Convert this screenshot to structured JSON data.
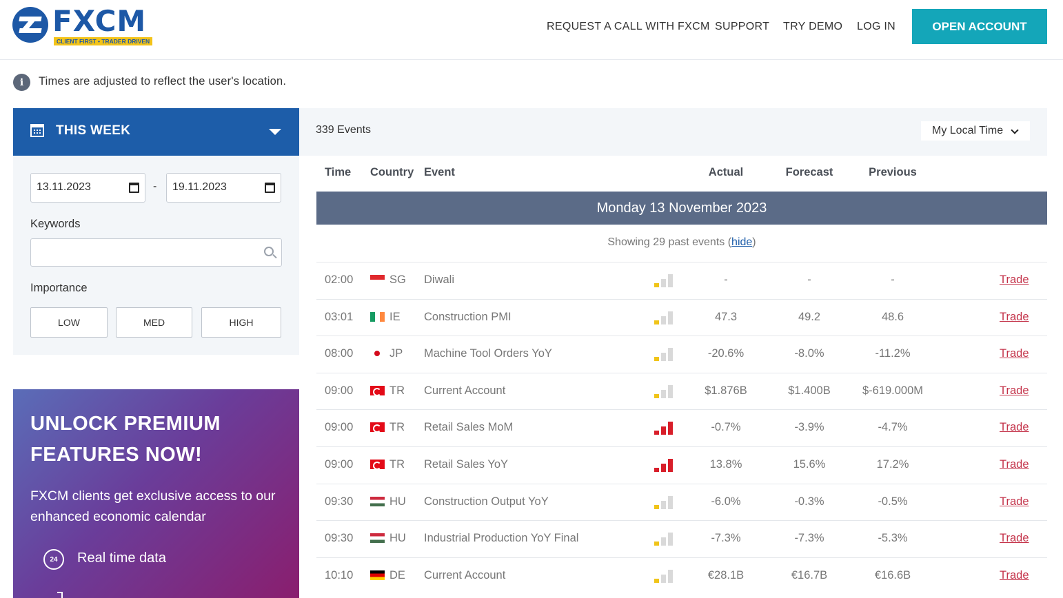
{
  "header": {
    "logo_text": "FXCM",
    "logo_tagline": "CLIENT FIRST • TRADER DRIVEN",
    "nav": [
      {
        "label": "REQUEST A CALL WITH FXCM"
      },
      {
        "label": "SUPPORT"
      },
      {
        "label": "TRY DEMO"
      },
      {
        "label": "LOG IN"
      }
    ],
    "open_account": "OPEN ACCOUNT"
  },
  "info": {
    "icon": "i",
    "text": "Times are adjusted to reflect the user's location."
  },
  "filters": {
    "period": "THIS WEEK",
    "date_from": "13.11.2023",
    "date_sep": "-",
    "date_to": "19.11.2023",
    "keywords_label": "Keywords",
    "keywords_value": "",
    "importance_label": "Importance",
    "importance_buttons": [
      "LOW",
      "MED",
      "HIGH"
    ]
  },
  "promo": {
    "title_line1": "UNLOCK PREMIUM",
    "title_line2": "FEATURES NOW!",
    "description": "FXCM clients get exclusive access to our enhanced economic calendar",
    "feature_icon_text": "24",
    "feature": "Real time data"
  },
  "events": {
    "count": "339 Events",
    "timezone": "My Local Time",
    "columns": {
      "time": "Time",
      "country": "Country",
      "event": "Event",
      "actual": "Actual",
      "forecast": "Forecast",
      "previous": "Previous"
    },
    "day_header": "Monday 13 November 2023",
    "showing_prefix": "Showing 29 past events (",
    "showing_link": "hide",
    "showing_suffix": ")",
    "colors": {
      "low": "#f0c419",
      "inactive": "#d9d9d9",
      "high": "#d81e2a"
    },
    "rows": [
      {
        "time": "02:00",
        "flag": "sg",
        "country": "SG",
        "event": "Diwali",
        "importance": 1,
        "actual": "-",
        "forecast": "-",
        "previous": "-",
        "trade": "Trade"
      },
      {
        "time": "03:01",
        "flag": "ie",
        "country": "IE",
        "event": "Construction PMI",
        "importance": 1,
        "actual": "47.3",
        "forecast": "49.2",
        "previous": "48.6",
        "trade": "Trade"
      },
      {
        "time": "08:00",
        "flag": "jp",
        "country": "JP",
        "event": "Machine Tool Orders YoY",
        "importance": 1,
        "actual": "-20.6%",
        "forecast": "-8.0%",
        "previous": "-11.2%",
        "trade": "Trade"
      },
      {
        "time": "09:00",
        "flag": "tr",
        "country": "TR",
        "event": "Current Account",
        "importance": 1,
        "actual": "$1.876B",
        "forecast": "$1.400B",
        "previous": "$-619.000M",
        "trade": "Trade"
      },
      {
        "time": "09:00",
        "flag": "tr",
        "country": "TR",
        "event": "Retail Sales MoM",
        "importance": 3,
        "actual": "-0.7%",
        "forecast": "-3.9%",
        "previous": "-4.7%",
        "trade": "Trade"
      },
      {
        "time": "09:00",
        "flag": "tr",
        "country": "TR",
        "event": "Retail Sales YoY",
        "importance": 3,
        "actual": "13.8%",
        "forecast": "15.6%",
        "previous": "17.2%",
        "trade": "Trade"
      },
      {
        "time": "09:30",
        "flag": "hu",
        "country": "HU",
        "event": "Construction Output YoY",
        "importance": 1,
        "actual": "-6.0%",
        "forecast": "-0.3%",
        "previous": "-0.5%",
        "trade": "Trade"
      },
      {
        "time": "09:30",
        "flag": "hu",
        "country": "HU",
        "event": "Industrial Production YoY Final",
        "importance": 1,
        "actual": "-7.3%",
        "forecast": "-7.3%",
        "previous": "-5.3%",
        "trade": "Trade"
      },
      {
        "time": "10:10",
        "flag": "de",
        "country": "DE",
        "event": "Current Account",
        "importance": 1,
        "actual": "€28.1B",
        "forecast": "€16.7B",
        "previous": "€16.6B",
        "trade": "Trade"
      }
    ]
  }
}
